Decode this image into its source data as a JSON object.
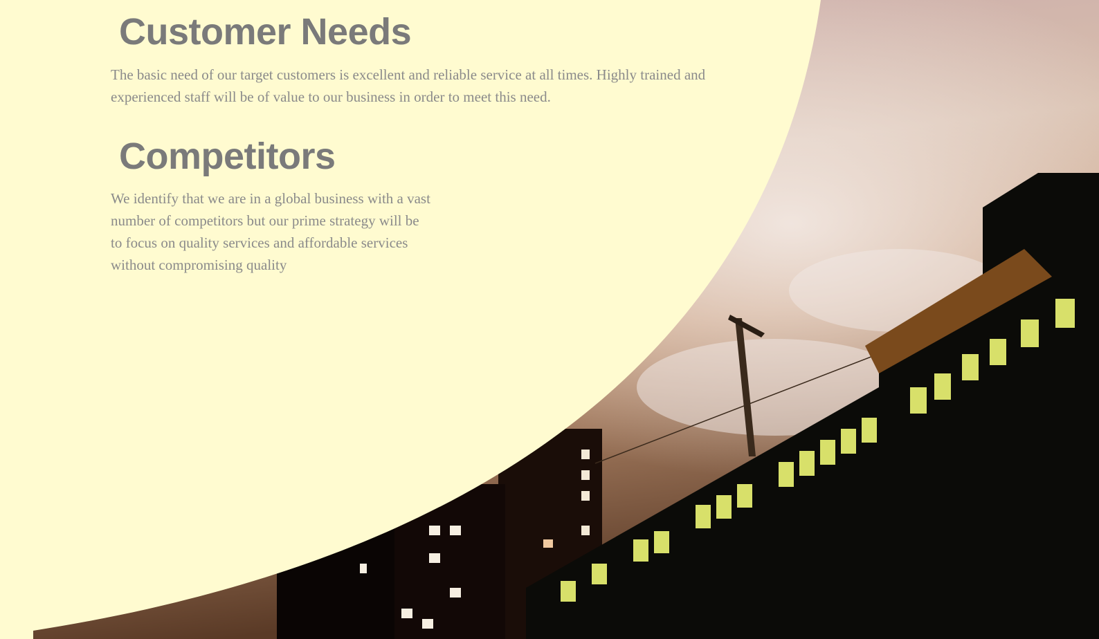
{
  "slide": {
    "colors": {
      "panel": "#fffbd0",
      "heading": "#7a7a7a",
      "body_text": "#8a8a8a"
    },
    "background_image": "night-city-buildings-photo",
    "sections": [
      {
        "heading": "Customer Needs",
        "lines": [
          "The basic need of our target customers is excellent and reliable service at all times. Highly trained and",
          "experienced staff will be of value to our business in order to meet this need."
        ]
      },
      {
        "heading": "Competitors",
        "lines": [
          "We identify that we are in a global business with a vast",
          "number of competitors but our prime strategy will be",
          "to focus on quality services and affordable services",
          "without compromising quality"
        ]
      }
    ]
  }
}
